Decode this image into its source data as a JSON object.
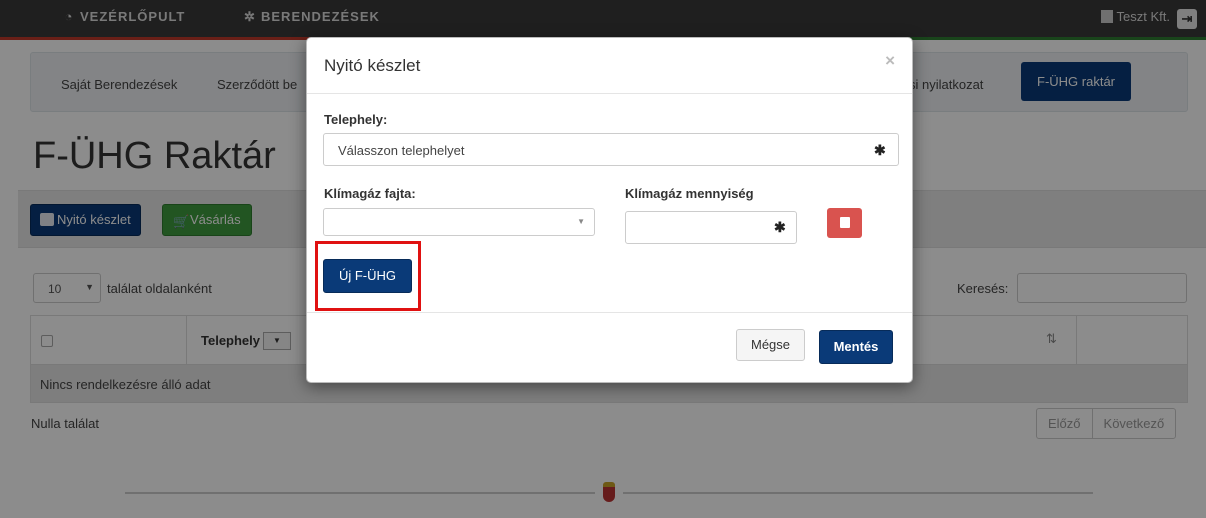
{
  "topnav": {
    "dashboard_icon": "gauge-icon",
    "dashboard_label": "VEZÉRLŐPULT",
    "devices_icon": "gear-icon",
    "devices_label": "BERENDEZÉSEK",
    "company_icon": "building-icon",
    "company_label": "Teszt Kft.",
    "logout_icon": "logout-icon"
  },
  "subnav": {
    "items": [
      {
        "label": "Saját Berendezések"
      },
      {
        "label": "Szerződött be"
      },
      {
        "label": "si nyilatkozat"
      }
    ],
    "active_label": "F-ÜHG raktár"
  },
  "page": {
    "title": "F-ÜHG Raktár",
    "open_stock_label": "Nyitó készlet",
    "purchase_label": "Vásárlás"
  },
  "table": {
    "per_page_value": "10",
    "per_page_label": "találat oldalanként",
    "search_label": "Keresés:",
    "search_value": "",
    "column_site": "Telephely",
    "empty_text": "Nincs rendelkezésre álló adat",
    "total_text": "Nulla találat",
    "pager_prev": "Előző",
    "pager_next": "Következő"
  },
  "modal": {
    "title": "Nyitó készlet",
    "close_symbol": "×",
    "site_label": "Telephely:",
    "site_placeholder": "Válasszon telephelyet",
    "gas_type_label": "Klímagáz fajta:",
    "gas_type_value": "",
    "gas_qty_label": "Klímagáz mennyiség",
    "gas_qty_value": "",
    "required_mark": "✱",
    "new_button_label": "Új F-ÜHG",
    "cancel_label": "Mégse",
    "save_label": "Mentés"
  },
  "colors": {
    "primary": "#0a3a78",
    "success": "#3f9b3f",
    "danger": "#d9534f",
    "highlight": "#e01111"
  }
}
